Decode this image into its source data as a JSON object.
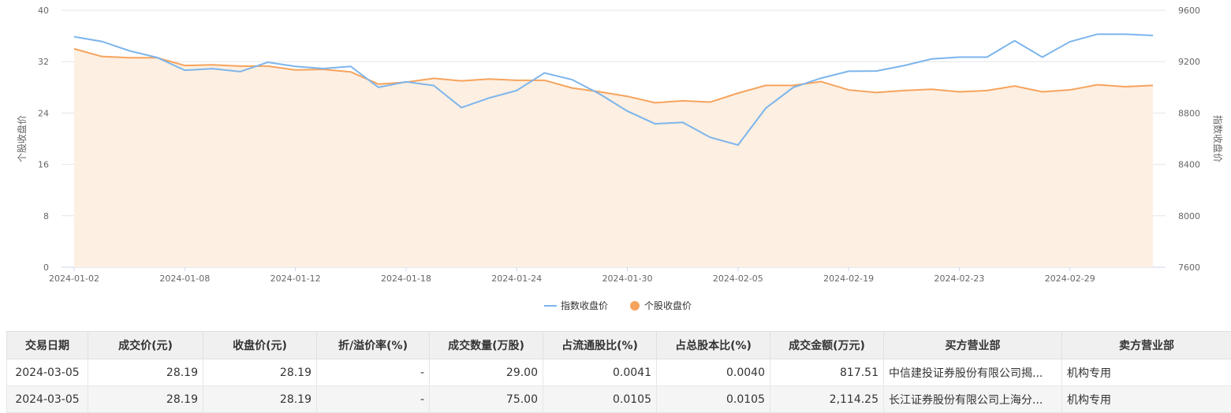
{
  "chart_data": {
    "type": "line",
    "x": [
      "2024-01-02",
      "2024-01-03",
      "2024-01-04",
      "2024-01-05",
      "2024-01-08",
      "2024-01-09",
      "2024-01-10",
      "2024-01-11",
      "2024-01-12",
      "2024-01-15",
      "2024-01-16",
      "2024-01-17",
      "2024-01-18",
      "2024-01-19",
      "2024-01-22",
      "2024-01-23",
      "2024-01-24",
      "2024-01-25",
      "2024-01-26",
      "2024-01-29",
      "2024-01-30",
      "2024-01-31",
      "2024-02-01",
      "2024-02-02",
      "2024-02-05",
      "2024-02-06",
      "2024-02-07",
      "2024-02-08",
      "2024-02-19",
      "2024-02-20",
      "2024-02-21",
      "2024-02-22",
      "2024-02-23",
      "2024-02-26",
      "2024-02-27",
      "2024-02-28",
      "2024-02-29",
      "2024-03-01",
      "2024-03-04",
      "2024-03-05"
    ],
    "x_tick_labels": [
      "2024-01-02",
      "2024-01-08",
      "2024-01-12",
      "2024-01-18",
      "2024-01-24",
      "2024-01-30",
      "2024-02-05",
      "2024-02-19",
      "2024-02-23",
      "2024-02-29"
    ],
    "series": [
      {
        "name": "指数收盘价",
        "axis": "right",
        "color": "#7cb5ec",
        "values": [
          9394,
          9357,
          9284,
          9232,
          9133,
          9145,
          9122,
          9195,
          9163,
          9146,
          9163,
          9000,
          9043,
          9014,
          8842,
          8917,
          8975,
          9112,
          9060,
          8948,
          8815,
          8716,
          8727,
          8610,
          8551,
          8837,
          9000,
          9071,
          9125,
          9127,
          9169,
          9221,
          9235,
          9235,
          9363,
          9235,
          9355,
          9414,
          9414,
          9404
        ]
      },
      {
        "name": "个股收盘价",
        "axis": "left",
        "color": "#f7a35c",
        "area_fill": "#fdefe2",
        "values": [
          34.0,
          32.8,
          32.6,
          32.6,
          31.4,
          31.5,
          31.3,
          31.3,
          30.7,
          30.8,
          30.4,
          28.5,
          28.8,
          29.4,
          29.0,
          29.3,
          29.1,
          29.1,
          27.9,
          27.3,
          26.6,
          25.6,
          25.9,
          25.7,
          27.1,
          28.3,
          28.3,
          28.9,
          27.6,
          27.2,
          27.5,
          27.7,
          27.3,
          27.5,
          28.2,
          27.3,
          27.6,
          28.4,
          28.1,
          28.3
        ]
      }
    ],
    "y_left": {
      "label": "个股收盘价",
      "range": [
        0,
        40
      ],
      "ticks": [
        0,
        8,
        16,
        24,
        32,
        40
      ]
    },
    "y_right": {
      "label": "指数收盘价",
      "range": [
        7600,
        9600
      ],
      "ticks": [
        7600,
        8000,
        8400,
        8800,
        9200,
        9600
      ]
    },
    "grid": true,
    "legend": {
      "position": "bottom-center",
      "items": [
        "指数收盘价",
        "个股收盘价"
      ]
    }
  },
  "table": {
    "headers": [
      "交易日期",
      "成交价(元)",
      "收盘价(元)",
      "折/溢价率(%)",
      "成交数量(万股)",
      "占流通股比(%)",
      "占总股本比(%)",
      "成交金额(万元)",
      "买方营业部",
      "卖方营业部"
    ],
    "rows": [
      [
        "2024-03-05",
        "28.19",
        "28.19",
        "-",
        "29.00",
        "0.0041",
        "0.0040",
        "817.51",
        "中信建投证券股份有限公司揭...",
        "机构专用"
      ],
      [
        "2024-03-05",
        "28.19",
        "28.19",
        "-",
        "75.00",
        "0.0105",
        "0.0105",
        "2,114.25",
        "长江证券股份有限公司上海分...",
        "机构专用"
      ]
    ]
  }
}
